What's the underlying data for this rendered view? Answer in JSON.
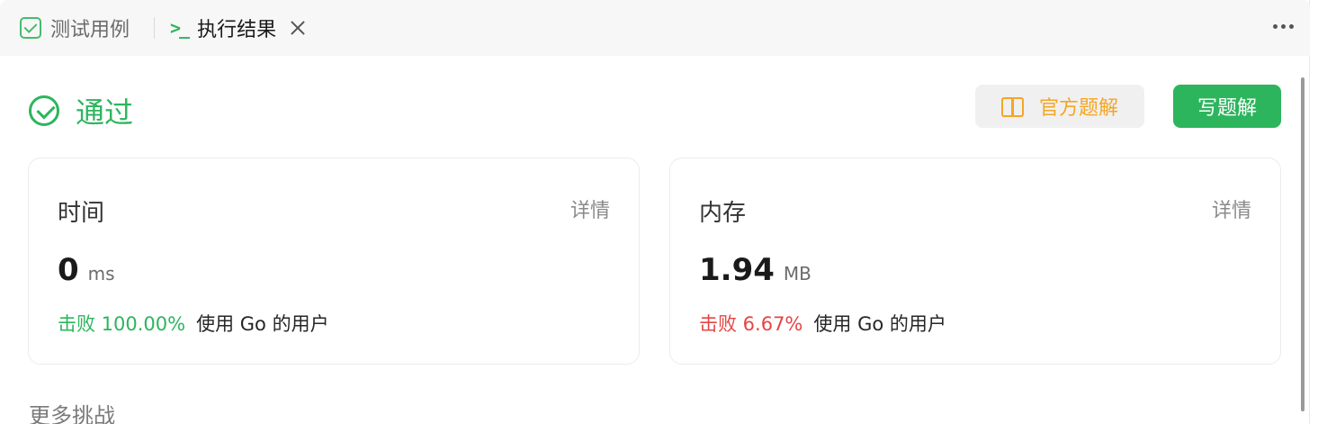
{
  "tabs": {
    "test_cases": "测试用例",
    "result": "执行结果"
  },
  "status": {
    "label": "通过",
    "color": "#2db55d"
  },
  "buttons": {
    "official_solution": "官方题解",
    "write_solution": "写题解"
  },
  "cards": {
    "time": {
      "title": "时间",
      "detail": "详情",
      "value": "0",
      "unit": "ms",
      "beat_label": "击败 100.00%",
      "beat_suffix": "使用 Go 的用户",
      "beat_color": "#2db55d"
    },
    "memory": {
      "title": "内存",
      "detail": "详情",
      "value": "1.94",
      "unit": "MB",
      "beat_label": "击败 6.67%",
      "beat_suffix": "使用 Go 的用户",
      "beat_color": "#e54545"
    }
  },
  "more_challenges": "更多挑战",
  "icons": [
    "checkbox-icon",
    "terminal-icon",
    "close-icon",
    "more-icon",
    "check-circle-icon",
    "book-icon"
  ]
}
